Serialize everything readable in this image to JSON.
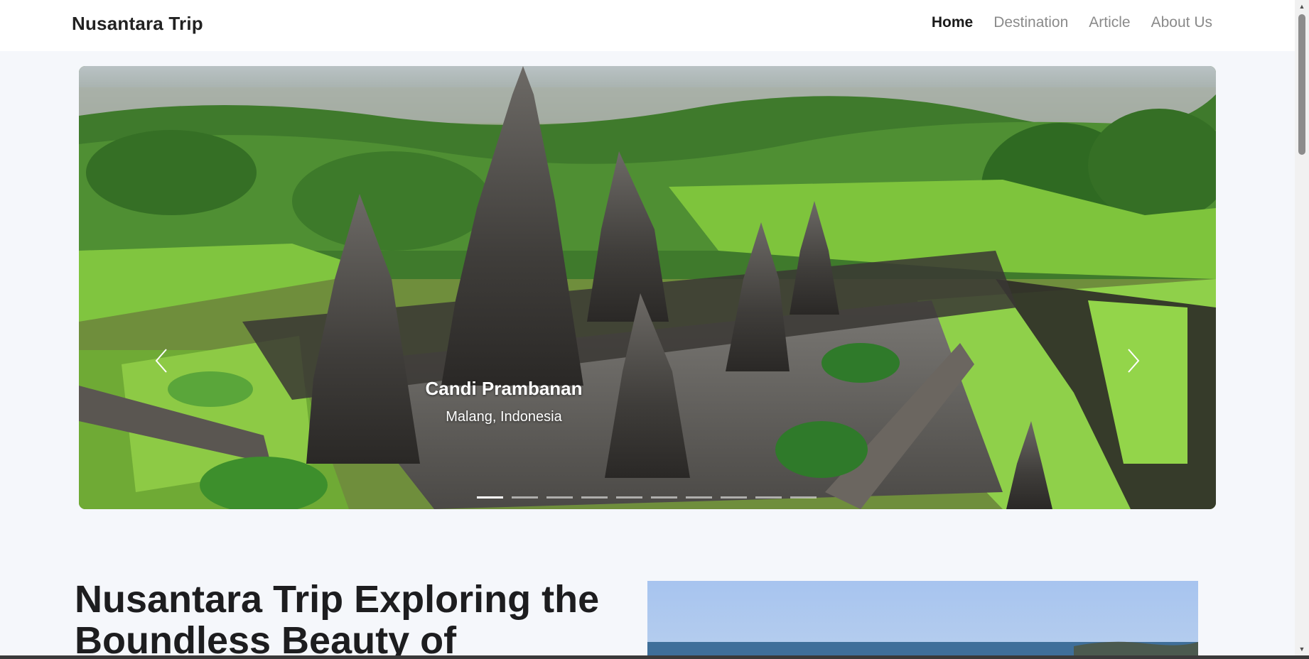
{
  "navbar": {
    "brand": "Nusantara Trip",
    "links": [
      {
        "label": "Home",
        "active": true
      },
      {
        "label": "Destination",
        "active": false
      },
      {
        "label": "Article",
        "active": false
      },
      {
        "label": "About Us",
        "active": false
      }
    ]
  },
  "carousel": {
    "slide_title": "Candi Prambanan",
    "slide_subtitle": "Malang, Indonesia",
    "indicator_count": 10,
    "active_index": 0,
    "prev_icon": "chevron-left-icon",
    "next_icon": "chevron-right-icon"
  },
  "hero": {
    "title": "Nusantara Trip Exploring the Boundless Beauty of"
  },
  "colors": {
    "background": "#f5f7fb",
    "navbar_bg": "#ffffff",
    "nav_active": "#1a1a1a",
    "nav_inactive": "#8a8a8a",
    "heading": "#1d1d1f"
  }
}
